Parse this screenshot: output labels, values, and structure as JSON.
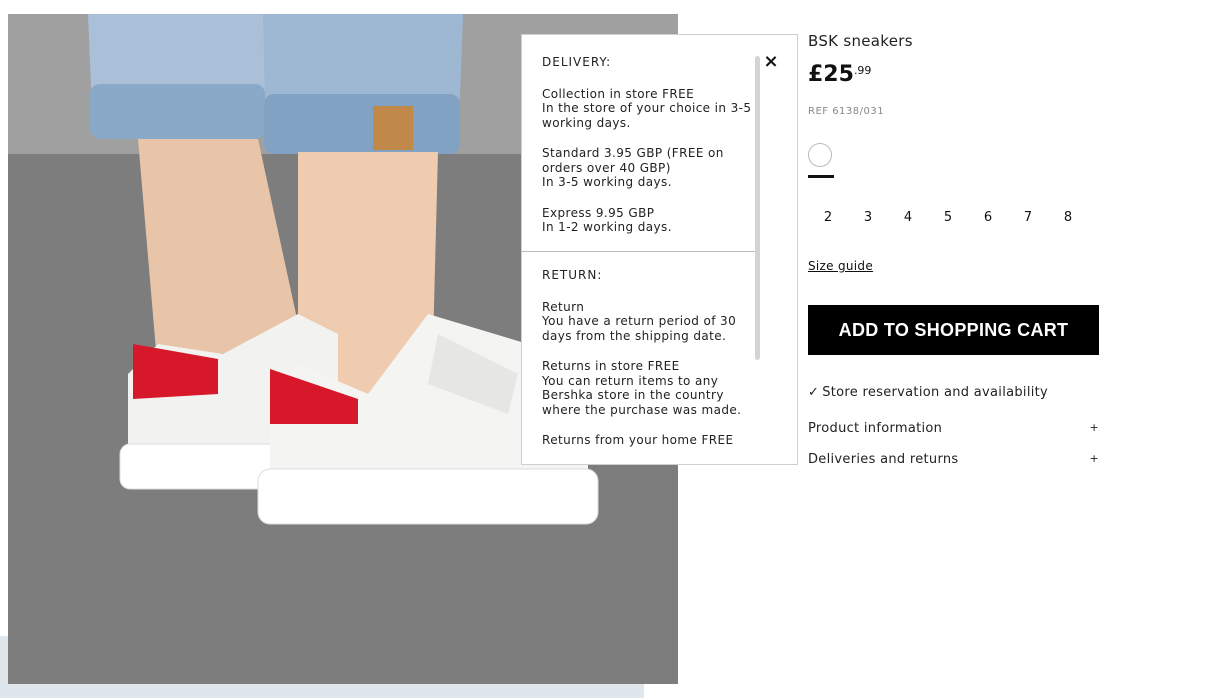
{
  "product": {
    "title": "BSK sneakers",
    "price_main": "£25",
    "price_cents": ".99",
    "ref": "REF 6138/031",
    "color_swatch": "#ffffff",
    "sizes": [
      "2",
      "3",
      "4",
      "5",
      "6",
      "7",
      "8"
    ],
    "size_guide_label": "Size guide",
    "add_to_cart_label": "ADD TO SHOPPING CART",
    "reserve_label": "Store reservation and availability",
    "accordion": [
      {
        "label": "Product information",
        "icon": "+"
      },
      {
        "label": "Deliveries and returns",
        "icon": "+"
      }
    ]
  },
  "popup": {
    "close_icon": "×",
    "delivery_heading": "DELIVERY:",
    "delivery_items": [
      [
        "Collection in store FREE",
        "In the store of your choice in 3-5",
        "working days."
      ],
      [
        "Standard 3.95 GBP (FREE on",
        "orders over 40 GBP)",
        "In 3-5 working days."
      ],
      [
        "Express 9.95 GBP",
        "In 1-2 working days."
      ]
    ],
    "return_heading": "RETURN:",
    "return_items": [
      [
        "Return",
        "You have a return period of 30",
        "days from the shipping date."
      ],
      [
        "Returns in store FREE",
        "You can return items to any",
        "Bershka store in the country",
        "where the purchase was made."
      ],
      [
        "Returns from your home FREE"
      ]
    ]
  },
  "colors": {
    "button_bg": "#000000",
    "heel_tab": "#d7182a"
  }
}
